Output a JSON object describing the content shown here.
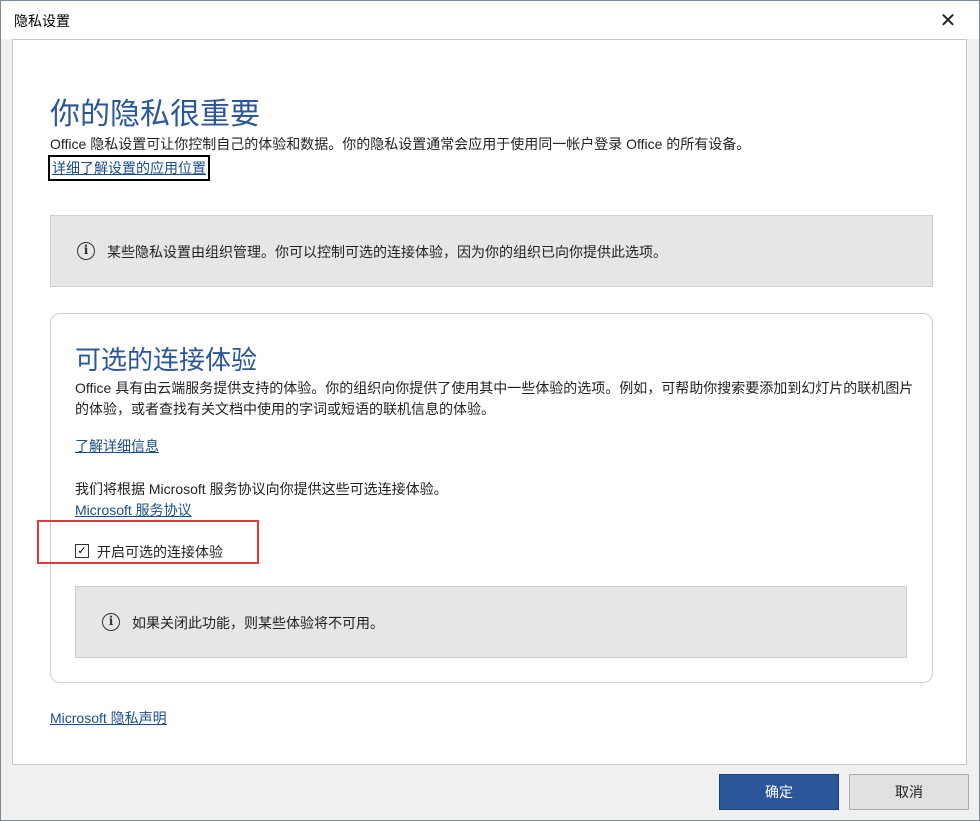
{
  "window": {
    "title": "隐私设置",
    "close_glyph": "✕"
  },
  "header": {
    "title": "你的隐私很重要",
    "intro": "Office 隐私设置可让你控制自己的体验和数据。你的隐私设置通常会应用于使用同一帐户登录 Office 的所有设备。",
    "learn_link": "详细了解设置的应用位置"
  },
  "org_banner": {
    "icon": "info-icon",
    "text": "某些隐私设置由组织管理。你可以控制可选的连接体验，因为你的组织已向你提供此选项。"
  },
  "optional_experiences": {
    "title": "可选的连接体验",
    "description": "Office 具有由云端服务提供支持的体验。你的组织向你提供了使用其中一些体验的选项。例如，可帮助你搜索要添加到幻灯片的联机图片的体验，或者查找有关文档中使用的字词或短语的联机信息的体验。",
    "learn_more_link": "了解详细信息",
    "agreement_text": "我们将根据 Microsoft 服务协议向你提供这些可选连接体验。",
    "agreement_link": "Microsoft 服务协议",
    "checkbox": {
      "label": "开启可选的连接体验",
      "checked": true,
      "check_glyph": "✓"
    },
    "warning_banner": {
      "icon": "info-icon",
      "text": "如果关闭此功能，则某些体验将不可用。"
    }
  },
  "footer": {
    "privacy_link": "Microsoft 隐私声明",
    "ok_label": "确定",
    "cancel_label": "取消"
  },
  "colors": {
    "accent": "#2b579a",
    "link": "#1a4f8c",
    "highlight": "#e23a3a"
  }
}
